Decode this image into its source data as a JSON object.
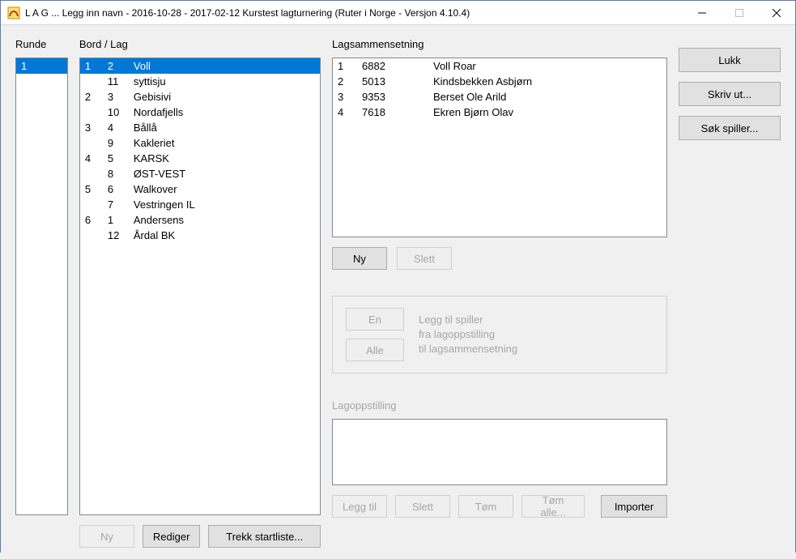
{
  "window": {
    "title": "L A G ... Legg inn navn - 2016-10-28 - 2017-02-12  Kurstest lagturnering  (Ruter i Norge - Versjon 4.10.4)"
  },
  "labels": {
    "runde": "Runde",
    "bord_lag": "Bord / Lag",
    "lagsammensetning": "Lagsammensetning",
    "lagoppstilling": "Lagoppstilling"
  },
  "runde_list": [
    "1"
  ],
  "bord_lag": [
    {
      "board": "1",
      "team": "2",
      "name": "Voll",
      "selected": true
    },
    {
      "board": "",
      "team": "11",
      "name": "syttisju",
      "selected": false
    },
    {
      "board": "2",
      "team": "3",
      "name": "Gebisivi",
      "selected": false
    },
    {
      "board": "",
      "team": "10",
      "name": "Nordafjells",
      "selected": false
    },
    {
      "board": "3",
      "team": "4",
      "name": "Bållå",
      "selected": false
    },
    {
      "board": "",
      "team": "9",
      "name": "Kakleriet",
      "selected": false
    },
    {
      "board": "4",
      "team": "5",
      "name": "KARSK",
      "selected": false
    },
    {
      "board": "",
      "team": "8",
      "name": "ØST-VEST",
      "selected": false
    },
    {
      "board": "5",
      "team": "6",
      "name": "Walkover",
      "selected": false
    },
    {
      "board": "",
      "team": "7",
      "name": "Vestringen IL",
      "selected": false
    },
    {
      "board": "6",
      "team": "1",
      "name": "Andersens",
      "selected": false
    },
    {
      "board": "",
      "team": "12",
      "name": "Årdal BK",
      "selected": false
    }
  ],
  "lagsammensetning": [
    {
      "idx": "1",
      "id": "6882",
      "name": "Voll Roar"
    },
    {
      "idx": "2",
      "id": "5013",
      "name": "Kindsbekken Asbjørn"
    },
    {
      "idx": "3",
      "id": "9353",
      "name": "Berset Ole Arild"
    },
    {
      "idx": "4",
      "id": "7618",
      "name": "Ekren Bjørn Olav"
    }
  ],
  "buttons": {
    "lukk": "Lukk",
    "skriv_ut": "Skriv ut...",
    "sok_spiller": "Søk spiller...",
    "ny": "Ny",
    "slett": "Slett",
    "en": "En",
    "alle": "Alle",
    "rediger": "Rediger",
    "trekk_startliste": "Trekk startliste...",
    "legg_til": "Legg til",
    "tom": "Tøm",
    "tom_alle": "Tøm alle...",
    "importer": "Importer"
  },
  "groupbox": {
    "line1": "Legg til spiller",
    "line2": "fra lagoppstilling",
    "line3": "til lagsammensetning"
  }
}
